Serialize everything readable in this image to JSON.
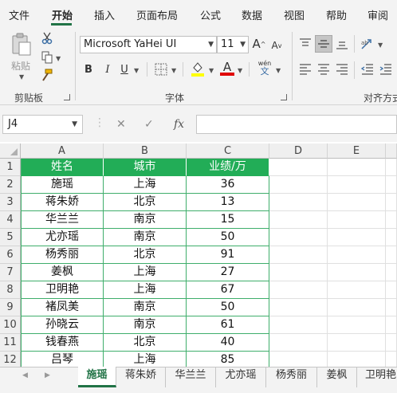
{
  "menu": {
    "tabs": [
      "文件",
      "开始",
      "插入",
      "页面布局",
      "公式",
      "数据",
      "视图",
      "帮助",
      "审阅"
    ],
    "active": "开始"
  },
  "ribbon": {
    "clipboard": {
      "group_label": "剪贴板",
      "paste_label": "粘贴"
    },
    "font": {
      "group_label": "字体",
      "font_name": "Microsoft YaHei UI",
      "font_size": "11",
      "bold": "B",
      "italic": "I",
      "underline": "U",
      "grow": "A",
      "shrink": "A",
      "phonetic_top": "wén",
      "phonetic_bottom": "文",
      "font_color_glyph": "A",
      "highlight_color": "#ffff00",
      "font_color": "#e00000"
    },
    "alignment": {
      "group_label": "对齐方式"
    }
  },
  "formula_bar": {
    "name_box": "J4",
    "fx": "fx",
    "value": ""
  },
  "grid": {
    "columns": [
      "A",
      "B",
      "C",
      "D",
      "E"
    ],
    "rows": [
      "1",
      "2",
      "3",
      "4",
      "5",
      "6",
      "7",
      "8",
      "9",
      "10",
      "11",
      "12"
    ],
    "header": [
      "姓名",
      "城市",
      "业绩/万"
    ],
    "data": [
      [
        "施瑶",
        "上海",
        "36"
      ],
      [
        "蒋朱娇",
        "北京",
        "13"
      ],
      [
        "华兰兰",
        "南京",
        "15"
      ],
      [
        "尤亦瑶",
        "南京",
        "50"
      ],
      [
        "杨秀丽",
        "北京",
        "91"
      ],
      [
        "姜枫",
        "上海",
        "27"
      ],
      [
        "卫明艳",
        "上海",
        "67"
      ],
      [
        "褚凤美",
        "南京",
        "50"
      ],
      [
        "孙晓云",
        "南京",
        "61"
      ],
      [
        "钱春燕",
        "北京",
        "40"
      ],
      [
        "吕琴",
        "上海",
        "85"
      ]
    ],
    "header_color": "#22ad57"
  },
  "sheets": {
    "tabs": [
      "施瑶",
      "蒋朱娇",
      "华兰兰",
      "尤亦瑶",
      "杨秀丽",
      "姜枫",
      "卫明艳"
    ],
    "active": "施瑶"
  }
}
